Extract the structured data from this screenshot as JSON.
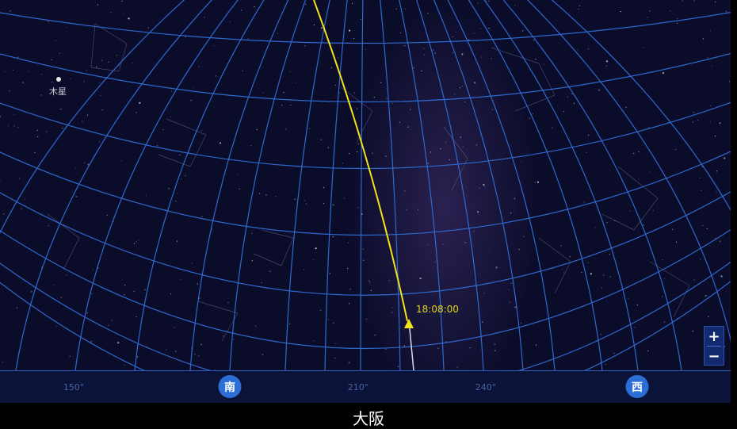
{
  "jupiter": {
    "label": "木星"
  },
  "track_time": "18:08:00",
  "compass": {
    "azimuth_labels": [
      "150°",
      "210°",
      "240°"
    ],
    "directions": [
      "南",
      "西"
    ]
  },
  "zoom": {
    "plus": "+",
    "minus": "−"
  },
  "location": "大阪",
  "colors": {
    "sky": "#0b0c2a",
    "grid": "#2f6fd8",
    "track": "#f2e21a",
    "badge": "#2d6ed6"
  }
}
